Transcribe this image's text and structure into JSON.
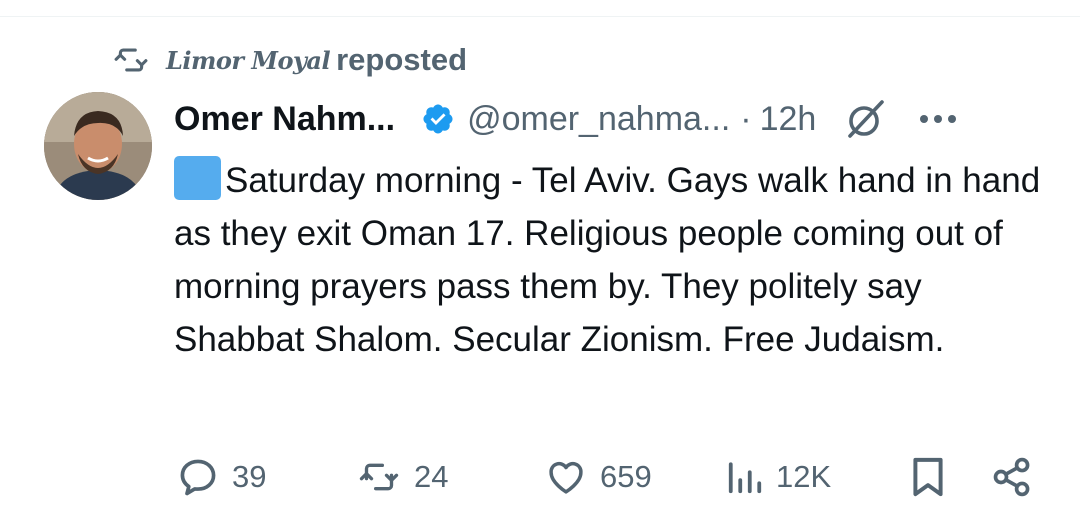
{
  "repost": {
    "reposter": "Limor Moyal",
    "label": "reposted"
  },
  "tweet": {
    "author_name": "Omer Nahm...",
    "handle": "@omer_nahma...",
    "separator": "·",
    "time": "12h",
    "text": "Saturday morning - Tel Aviv. Gays walk hand in hand as they exit Oman 17. Religious people coming out of morning prayers pass them by. They politely say Shabbat Shalom. Secular Zionism. Free Judaism.",
    "emoji": "blue-square-emoji"
  },
  "actions": {
    "replies": "39",
    "reposts": "24",
    "likes": "659",
    "views": "12K"
  },
  "icons": {
    "repost": "repost-icon",
    "verified": "verified-badge-icon",
    "grok": "grok-icon",
    "more": "more-icon",
    "reply": "reply-icon",
    "like": "heart-icon",
    "views": "views-icon",
    "bookmark": "bookmark-icon",
    "share": "share-icon"
  },
  "colors": {
    "text": "#0f1419",
    "secondary": "#536471",
    "verified": "#1d9bf0",
    "emoji_blue": "#55acee"
  }
}
